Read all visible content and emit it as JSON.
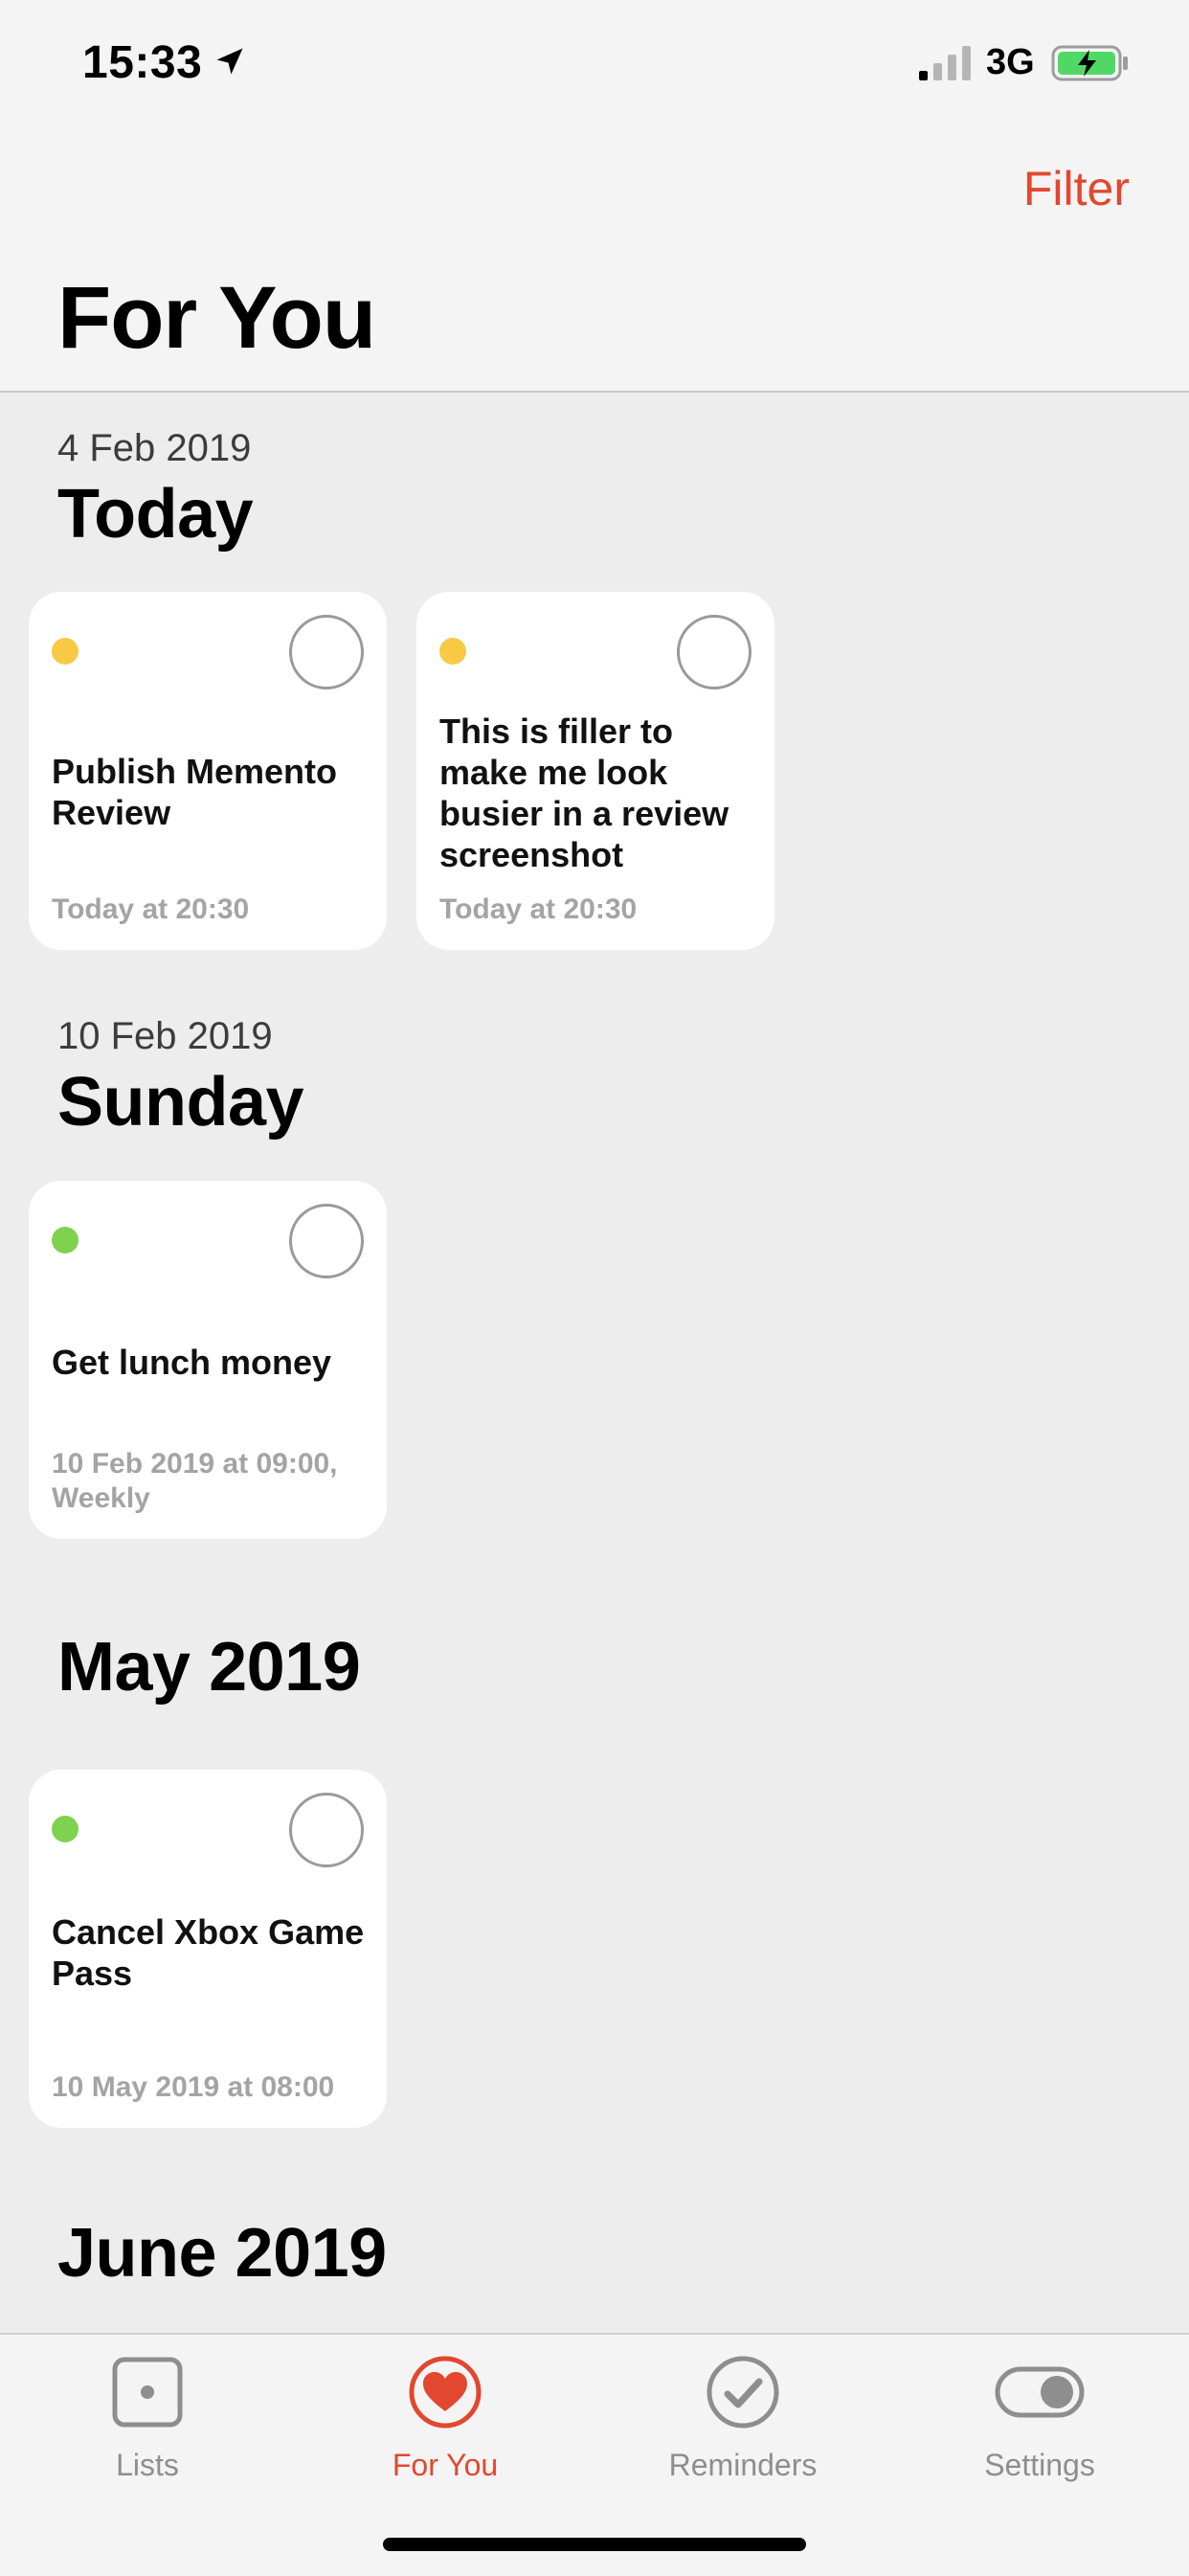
{
  "status_bar": {
    "time": "15:33",
    "network": "3G"
  },
  "header": {
    "filter_label": "Filter",
    "title": "For You"
  },
  "sections": [
    {
      "date": "4 Feb 2019",
      "title": "Today",
      "items": [
        {
          "title": "Publish Memento Review",
          "date": "Today at 20:30",
          "dot_color": "#f7c945"
        },
        {
          "title": "This is filler to make me look busier in a review screenshot",
          "date": "Today at 20:30",
          "dot_color": "#f7c945"
        }
      ]
    },
    {
      "date": "10 Feb 2019",
      "title": "Sunday",
      "items": [
        {
          "title": "Get lunch money",
          "date": "10 Feb 2019 at 09:00, Weekly",
          "dot_color": "#7ed24f"
        }
      ]
    },
    {
      "title": "May 2019",
      "items": [
        {
          "title": "Cancel Xbox Game Pass",
          "date": "10 May 2019 at 08:00",
          "dot_color": "#7ed24f"
        }
      ]
    },
    {
      "title": "June 2019"
    }
  ],
  "tabs": [
    {
      "label": "Lists",
      "icon": "lists-icon"
    },
    {
      "label": "For You",
      "icon": "heart-icon",
      "active": true
    },
    {
      "label": "Reminders",
      "icon": "checkmark-icon"
    },
    {
      "label": "Settings",
      "icon": "toggle-icon"
    }
  ],
  "colors": {
    "accent": "#e2472f",
    "yellow_dot": "#f7c945",
    "green_dot": "#7ed24f"
  }
}
